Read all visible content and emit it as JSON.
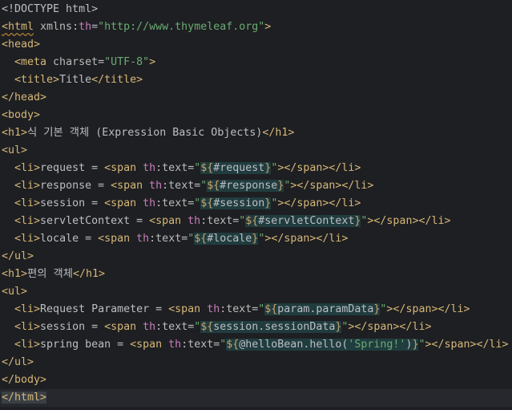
{
  "editor": {
    "language": "HTML (Thymeleaf template)",
    "theme_colors": {
      "background": "#1e1f22",
      "current_line": "#26282e",
      "tag": "#d5b778",
      "attribute": "#bababa",
      "namespace": "#c77dbb",
      "string": "#6aab73",
      "expression_highlight": "#203c3e"
    },
    "lines": [
      [
        {
          "t": "<!DOCTYPE html>",
          "c": "t-plain"
        }
      ],
      [
        {
          "t": "<html",
          "c": "t-tag squiggle"
        },
        {
          "t": " xmlns:",
          "c": "t-attr"
        },
        {
          "t": "th",
          "c": "t-ns"
        },
        {
          "t": "=",
          "c": "t-plain"
        },
        {
          "t": "\"http://www.thymeleaf.org\"",
          "c": "t-str"
        },
        {
          "t": ">",
          "c": "t-tag"
        }
      ],
      [
        {
          "t": "<head>",
          "c": "t-tag"
        }
      ],
      [
        {
          "t": "  ",
          "c": "t-plain"
        },
        {
          "t": "<meta",
          "c": "t-tag"
        },
        {
          "t": " charset",
          "c": "t-attr"
        },
        {
          "t": "=",
          "c": "t-plain"
        },
        {
          "t": "\"UTF-8\"",
          "c": "t-str"
        },
        {
          "t": ">",
          "c": "t-tag"
        }
      ],
      [
        {
          "t": "  ",
          "c": "t-plain"
        },
        {
          "t": "<title>",
          "c": "t-tag"
        },
        {
          "t": "Title",
          "c": "t-plain"
        },
        {
          "t": "</title>",
          "c": "t-tag"
        }
      ],
      [
        {
          "t": "</head>",
          "c": "t-tag"
        }
      ],
      [
        {
          "t": "<body>",
          "c": "t-tag"
        }
      ],
      [
        {
          "t": "<h1>",
          "c": "t-tag"
        },
        {
          "t": "식 기본 객체 (Expression Basic Objects)",
          "c": "t-plain"
        },
        {
          "t": "</h1>",
          "c": "t-tag"
        }
      ],
      [
        {
          "t": "<ul>",
          "c": "t-tag"
        }
      ],
      [
        {
          "t": "  ",
          "c": "t-plain"
        },
        {
          "t": "<li>",
          "c": "t-tag"
        },
        {
          "t": "request = ",
          "c": "t-plain"
        },
        {
          "t": "<span",
          "c": "t-tag"
        },
        {
          "t": " th",
          "c": "t-ns"
        },
        {
          "t": ":text",
          "c": "t-attr"
        },
        {
          "t": "=",
          "c": "t-plain"
        },
        {
          "t": "\"",
          "c": "t-str"
        },
        {
          "t": "${",
          "c": "t-expr hl"
        },
        {
          "t": "#request",
          "c": "t-exprvar hl"
        },
        {
          "t": "}",
          "c": "t-expr hl"
        },
        {
          "t": "\"",
          "c": "t-str"
        },
        {
          "t": "></span></li>",
          "c": "t-tag"
        }
      ],
      [
        {
          "t": "  ",
          "c": "t-plain"
        },
        {
          "t": "<li>",
          "c": "t-tag"
        },
        {
          "t": "response = ",
          "c": "t-plain"
        },
        {
          "t": "<span",
          "c": "t-tag"
        },
        {
          "t": " th",
          "c": "t-ns"
        },
        {
          "t": ":text",
          "c": "t-attr"
        },
        {
          "t": "=",
          "c": "t-plain"
        },
        {
          "t": "\"",
          "c": "t-str"
        },
        {
          "t": "${",
          "c": "t-expr hl"
        },
        {
          "t": "#response",
          "c": "t-exprvar hl"
        },
        {
          "t": "}",
          "c": "t-expr hl"
        },
        {
          "t": "\"",
          "c": "t-str"
        },
        {
          "t": "></span></li>",
          "c": "t-tag"
        }
      ],
      [
        {
          "t": "  ",
          "c": "t-plain"
        },
        {
          "t": "<li>",
          "c": "t-tag"
        },
        {
          "t": "session = ",
          "c": "t-plain"
        },
        {
          "t": "<span",
          "c": "t-tag"
        },
        {
          "t": " th",
          "c": "t-ns"
        },
        {
          "t": ":text",
          "c": "t-attr"
        },
        {
          "t": "=",
          "c": "t-plain"
        },
        {
          "t": "\"",
          "c": "t-str"
        },
        {
          "t": "${",
          "c": "t-expr hl"
        },
        {
          "t": "#session",
          "c": "t-exprvar hl"
        },
        {
          "t": "}",
          "c": "t-expr hl"
        },
        {
          "t": "\"",
          "c": "t-str"
        },
        {
          "t": "></span></li>",
          "c": "t-tag"
        }
      ],
      [
        {
          "t": "  ",
          "c": "t-plain"
        },
        {
          "t": "<li>",
          "c": "t-tag"
        },
        {
          "t": "servletContext = ",
          "c": "t-plain"
        },
        {
          "t": "<span",
          "c": "t-tag"
        },
        {
          "t": " th",
          "c": "t-ns"
        },
        {
          "t": ":text",
          "c": "t-attr"
        },
        {
          "t": "=",
          "c": "t-plain"
        },
        {
          "t": "\"",
          "c": "t-str"
        },
        {
          "t": "${",
          "c": "t-expr hl"
        },
        {
          "t": "#servletContext",
          "c": "t-exprvar hl"
        },
        {
          "t": "}",
          "c": "t-expr hl"
        },
        {
          "t": "\"",
          "c": "t-str"
        },
        {
          "t": "></span></li>",
          "c": "t-tag"
        }
      ],
      [
        {
          "t": "  ",
          "c": "t-plain"
        },
        {
          "t": "<li>",
          "c": "t-tag"
        },
        {
          "t": "locale = ",
          "c": "t-plain"
        },
        {
          "t": "<span",
          "c": "t-tag"
        },
        {
          "t": " th",
          "c": "t-ns"
        },
        {
          "t": ":text",
          "c": "t-attr"
        },
        {
          "t": "=",
          "c": "t-plain"
        },
        {
          "t": "\"",
          "c": "t-str"
        },
        {
          "t": "${",
          "c": "t-expr hl"
        },
        {
          "t": "#locale",
          "c": "t-exprvar hl"
        },
        {
          "t": "}",
          "c": "t-expr hl"
        },
        {
          "t": "\"",
          "c": "t-str"
        },
        {
          "t": "></span></li>",
          "c": "t-tag"
        }
      ],
      [
        {
          "t": "</ul>",
          "c": "t-tag"
        }
      ],
      [
        {
          "t": "<h1>",
          "c": "t-tag"
        },
        {
          "t": "편의 객체",
          "c": "t-plain"
        },
        {
          "t": "</h1>",
          "c": "t-tag"
        }
      ],
      [
        {
          "t": "<ul>",
          "c": "t-tag"
        }
      ],
      [
        {
          "t": "  ",
          "c": "t-plain"
        },
        {
          "t": "<li>",
          "c": "t-tag"
        },
        {
          "t": "Request Parameter = ",
          "c": "t-plain"
        },
        {
          "t": "<span",
          "c": "t-tag"
        },
        {
          "t": " th",
          "c": "t-ns"
        },
        {
          "t": ":text",
          "c": "t-attr"
        },
        {
          "t": "=",
          "c": "t-plain"
        },
        {
          "t": "\"",
          "c": "t-str"
        },
        {
          "t": "${",
          "c": "t-expr hl"
        },
        {
          "t": "param.paramData",
          "c": "t-exprvar hl"
        },
        {
          "t": "}",
          "c": "t-expr hl"
        },
        {
          "t": "\"",
          "c": "t-str"
        },
        {
          "t": "></span></li>",
          "c": "t-tag"
        }
      ],
      [
        {
          "t": "  ",
          "c": "t-plain"
        },
        {
          "t": "<li>",
          "c": "t-tag"
        },
        {
          "t": "session = ",
          "c": "t-plain"
        },
        {
          "t": "<span",
          "c": "t-tag"
        },
        {
          "t": " th",
          "c": "t-ns"
        },
        {
          "t": ":text",
          "c": "t-attr"
        },
        {
          "t": "=",
          "c": "t-plain"
        },
        {
          "t": "\"",
          "c": "t-str"
        },
        {
          "t": "${",
          "c": "t-expr hl"
        },
        {
          "t": "session.sessionData",
          "c": "t-exprvar hl"
        },
        {
          "t": "}",
          "c": "t-expr hl"
        },
        {
          "t": "\"",
          "c": "t-str"
        },
        {
          "t": "></span></li>",
          "c": "t-tag"
        }
      ],
      [
        {
          "t": "  ",
          "c": "t-plain"
        },
        {
          "t": "<li>",
          "c": "t-tag"
        },
        {
          "t": "spring bean = ",
          "c": "t-plain"
        },
        {
          "t": "<span",
          "c": "t-tag"
        },
        {
          "t": " th",
          "c": "t-ns"
        },
        {
          "t": ":text",
          "c": "t-attr"
        },
        {
          "t": "=",
          "c": "t-plain"
        },
        {
          "t": "\"",
          "c": "t-str"
        },
        {
          "t": "${",
          "c": "t-expr hl"
        },
        {
          "t": "@helloBean.hello(",
          "c": "t-exprvar hl"
        },
        {
          "t": "'Spring!'",
          "c": "t-str hl"
        },
        {
          "t": ")",
          "c": "t-exprvar hl"
        },
        {
          "t": "}",
          "c": "t-expr hl"
        },
        {
          "t": "\"",
          "c": "t-str"
        },
        {
          "t": "></span></li>",
          "c": "t-tag"
        }
      ],
      [
        {
          "t": "</ul>",
          "c": "t-tag"
        }
      ],
      [
        {
          "t": "</body>",
          "c": "t-tag"
        }
      ],
      [
        {
          "t": "</html>",
          "c": "t-tag caret-bracket"
        }
      ]
    ],
    "current_line_index": 22
  }
}
